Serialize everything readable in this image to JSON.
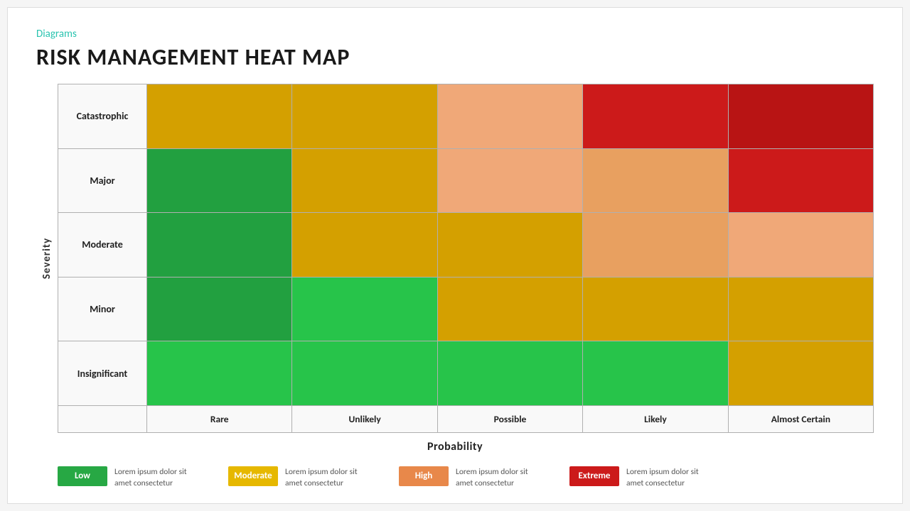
{
  "slide": {
    "category": "Diagrams",
    "title": "RISK MANAGEMENT HEAT MAP",
    "severity_axis_label": "Severity",
    "probability_axis_label": "Probability",
    "rows": [
      {
        "label": "Catastrophic",
        "cells": [
          "yellow",
          "yellow",
          "orange-light",
          "red-dark",
          "red-dark"
        ]
      },
      {
        "label": "Major",
        "cells": [
          "green",
          "yellow",
          "orange-light",
          "orange-light",
          "red-dark"
        ]
      },
      {
        "label": "Moderate",
        "cells": [
          "green",
          "yellow",
          "yellow",
          "orange-light",
          "orange-light"
        ]
      },
      {
        "label": "Minor",
        "cells": [
          "green",
          "green",
          "yellow",
          "yellow",
          "yellow"
        ]
      },
      {
        "label": "Insignificant",
        "cells": [
          "green",
          "green",
          "green",
          "green",
          "yellow"
        ]
      }
    ],
    "col_headers": [
      "Rare",
      "Unlikely",
      "Possible",
      "Likely",
      "Almost Certain"
    ],
    "legend": [
      {
        "label": "Low",
        "color": "#27a844",
        "text": "Lorem ipsum dolor sit amet consectetur"
      },
      {
        "label": "Moderate",
        "color": "#e6b800",
        "text": "Lorem ipsum dolor sit amet consectetur"
      },
      {
        "label": "High",
        "color": "#e8884a",
        "text": "Lorem ipsum dolor sit amet consectetur"
      },
      {
        "label": "Extreme",
        "color": "#cc1a1a",
        "text": "Lorem ipsum dolor sit amet consectetur"
      }
    ]
  }
}
